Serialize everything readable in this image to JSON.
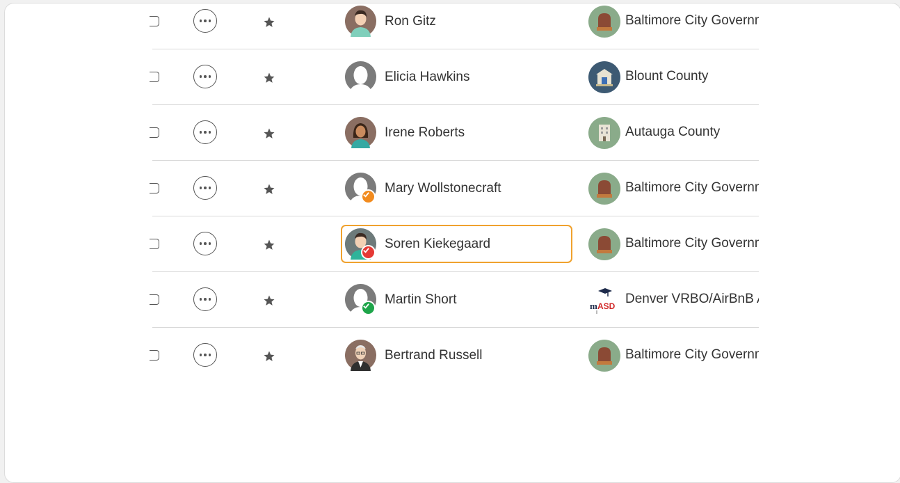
{
  "contacts": [
    {
      "name": "Ron Gitz",
      "organization": "Baltimore City Government",
      "avatar": "person-avatar-man-green-shirt",
      "badge": null,
      "org_icon": "tombstone-icon"
    },
    {
      "name": "Elicia Hawkins",
      "organization": "Blount County",
      "avatar": "default-avatar",
      "badge": null,
      "org_icon": "courthouse-icon"
    },
    {
      "name": "Irene Roberts",
      "organization": "Autauga County",
      "avatar": "person-avatar-woman",
      "badge": null,
      "org_icon": "building-icon"
    },
    {
      "name": "Mary Wollstonecraft",
      "organization": "Baltimore City Government",
      "avatar": "default-avatar",
      "badge": "orange-check-badge",
      "org_icon": "tombstone-icon"
    },
    {
      "name": "Soren Kiekegaard",
      "organization": "Baltimore City Government",
      "avatar": "person-avatar-man-green-shirt",
      "badge": "red-check-badge",
      "org_icon": "tombstone-icon",
      "highlighted": true
    },
    {
      "name": "Martin Short",
      "organization": "Denver VRBO/AirBnB Association",
      "avatar": "default-avatar",
      "badge": "green-check-badge",
      "org_icon": "masd-logo"
    },
    {
      "name": "Bertrand Russell",
      "organization": "Baltimore City Government",
      "avatar": "person-avatar-old-man",
      "badge": null,
      "org_icon": "tombstone-icon"
    }
  ],
  "colors": {
    "highlight": "#f0a22e",
    "badge_orange": "#f28b1e",
    "badge_red": "#e53935",
    "badge_green": "#1ea54a",
    "org_icon_bg": "#8aab8a",
    "courthouse_bg": "#3d5a73"
  }
}
